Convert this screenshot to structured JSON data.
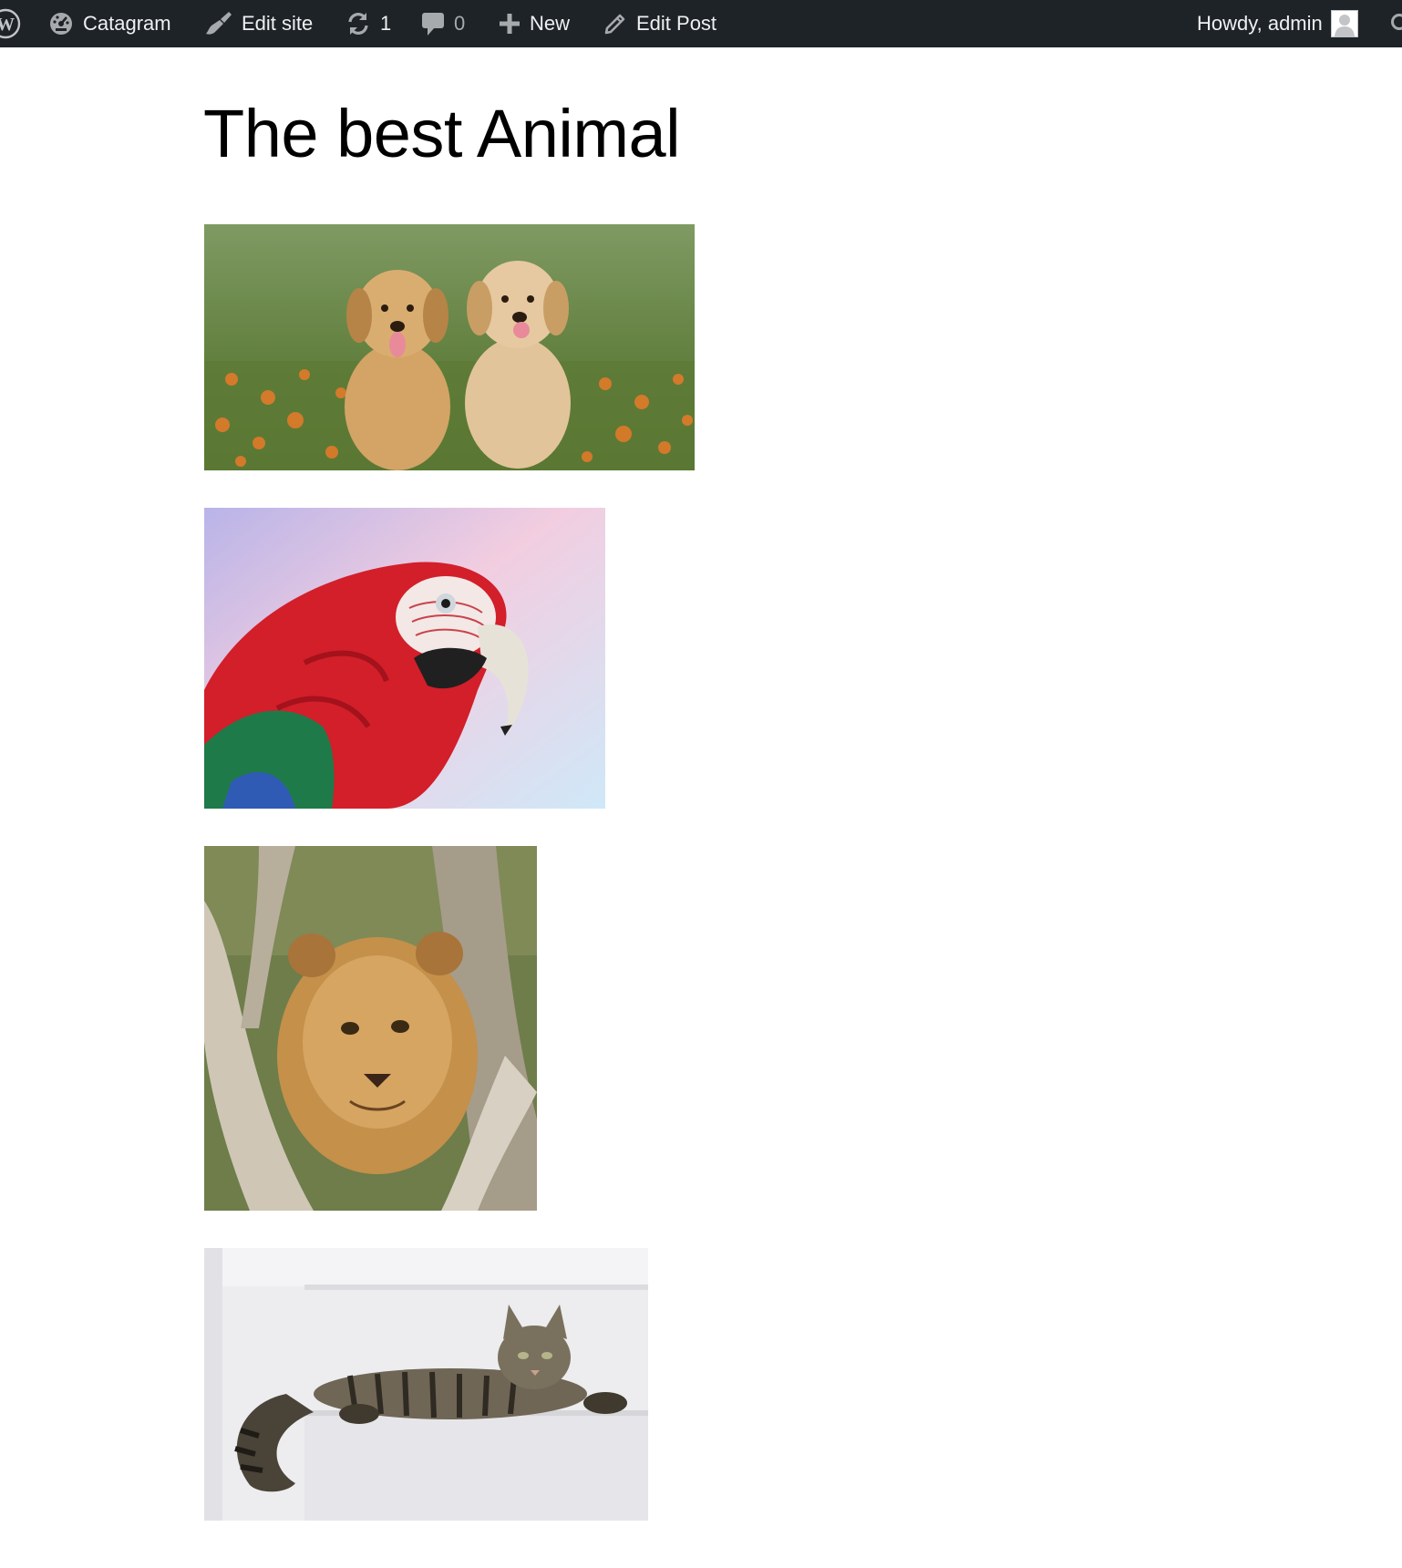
{
  "adminbar": {
    "site_name": "Catagram",
    "edit_site": "Edit site",
    "updates_count": "1",
    "comments_count": "0",
    "new_label": "New",
    "edit_post": "Edit Post",
    "howdy": "Howdy, admin",
    "icons": [
      "wordpress-logo-icon",
      "dashboard-icon",
      "brush-icon",
      "updates-icon",
      "comment-icon",
      "plus-icon",
      "pencil-icon",
      "avatar",
      "search-icon"
    ],
    "colors": {
      "background": "#1d2327",
      "text": "#f0f0f1",
      "muted": "#a7aaad"
    }
  },
  "post": {
    "title": "The best Animal"
  }
}
